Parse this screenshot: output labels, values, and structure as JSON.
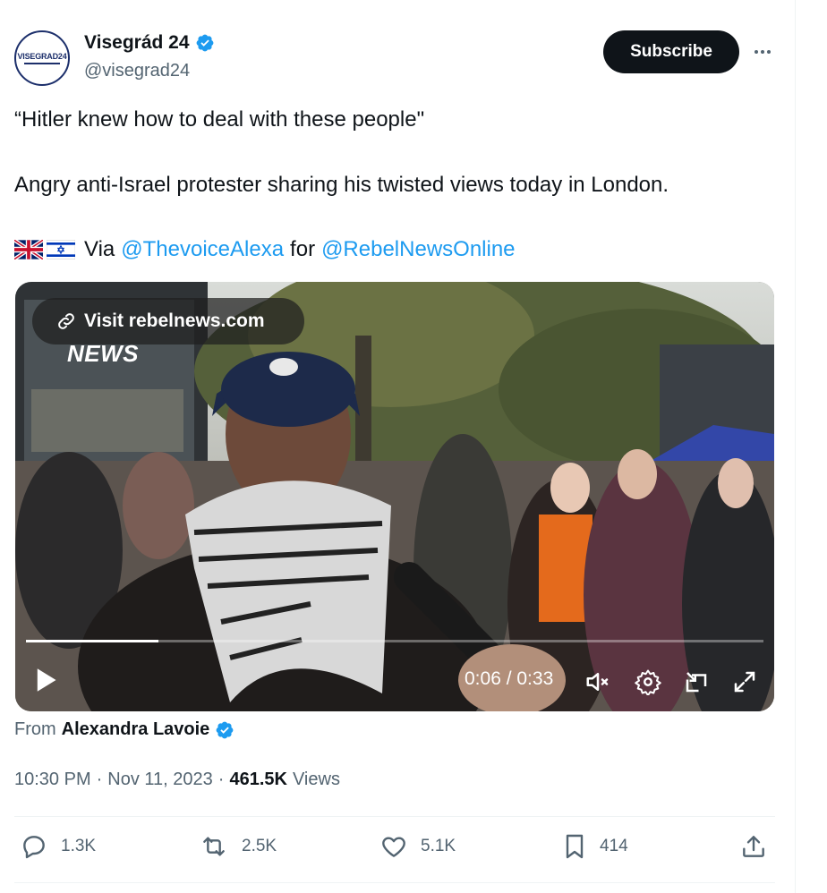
{
  "account": {
    "display_name": "Visegrád 24",
    "handle": "@visegrad24",
    "avatar_text": "VISEGRAD24"
  },
  "header": {
    "subscribe_label": "Subscribe",
    "more_icon": "more-icon"
  },
  "tweet": {
    "line1": "“Hitler knew how to deal with these people\"",
    "line2": "Angry anti-Israel protester sharing his twisted views today in London.",
    "via_prefix": "Via",
    "mention1": "@ThevoiceAlexa",
    "for_word": "for",
    "mention2": "@RebelNewsOnline",
    "flags": [
      "uk-flag-icon",
      "israel-flag-icon"
    ]
  },
  "video": {
    "visit_label": "Visit rebelnews.com",
    "watermark": "NEWS",
    "time": "0:06 / 0:33",
    "progress_fraction": 0.18
  },
  "attribution": {
    "from_label": "From",
    "from_name": "Alexandra Lavoie"
  },
  "meta": {
    "time": "10:30 PM",
    "date": "Nov 11, 2023",
    "views_count": "461.5K",
    "views_label": "Views"
  },
  "actions": {
    "replies": "1.3K",
    "reposts": "2.5K",
    "likes": "5.1K",
    "bookmarks": "414"
  },
  "colors": {
    "accent": "#1d9bf0",
    "text": "#0f1419",
    "muted": "#536471"
  }
}
